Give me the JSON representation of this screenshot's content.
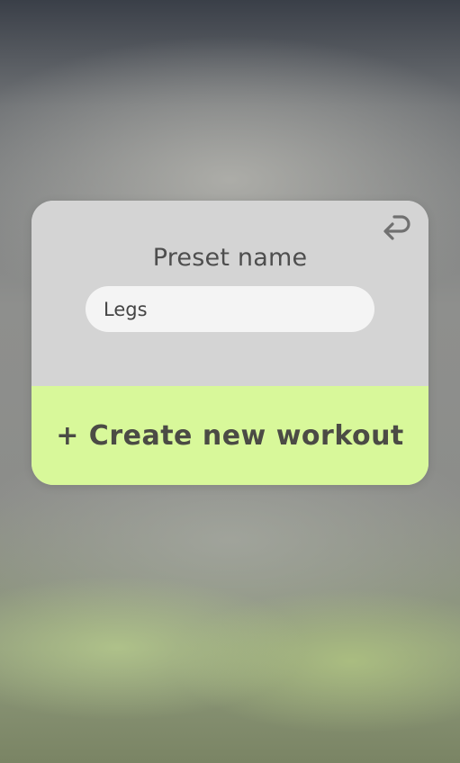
{
  "modal": {
    "back_icon": "return-arrow-icon",
    "preset_label": "Preset name",
    "name_input": {
      "value": "Legs",
      "placeholder": ""
    },
    "create_label": "+ Create new workout"
  },
  "colors": {
    "modal_bg": "#d4d4d4",
    "input_bg": "#f4f4f4",
    "accent": "#d8f89a",
    "text_dark": "#4b4b45"
  }
}
